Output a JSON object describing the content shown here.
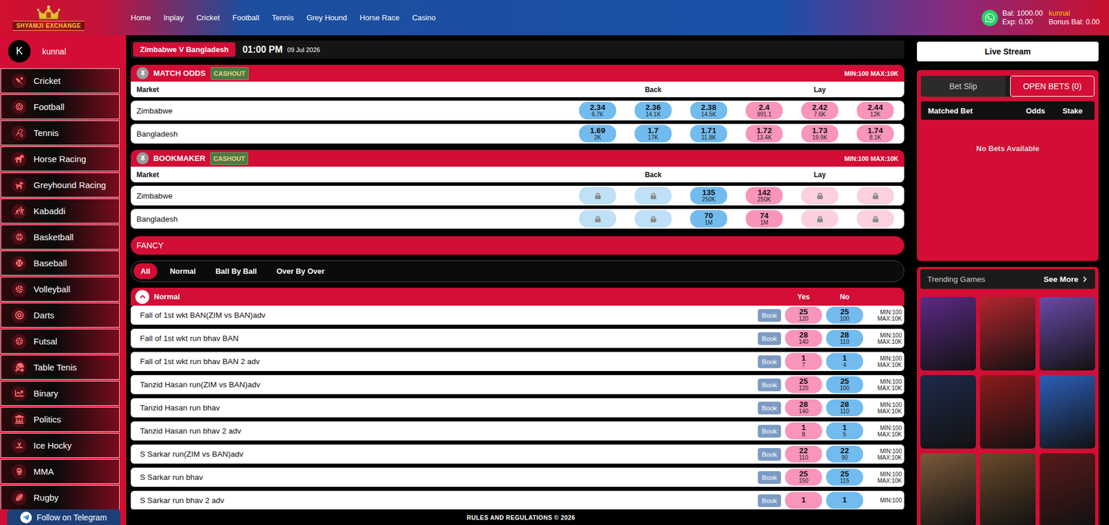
{
  "header": {
    "logo": {
      "left": "SHYAMJI",
      "right": "EXCHANGE"
    },
    "nav": [
      {
        "label": "Home"
      },
      {
        "label": "Inplay"
      },
      {
        "label": "Cricket"
      },
      {
        "label": "Football"
      },
      {
        "label": "Tennis"
      },
      {
        "label": "Grey Hound"
      },
      {
        "label": "Horse Race"
      },
      {
        "label": "Casino"
      }
    ],
    "balance": "Bal: 1000.00",
    "username": "kunnal",
    "exposure": "Exp: 0.00",
    "bonus": "Bonus Bal: 0.00"
  },
  "sidebar": {
    "user": {
      "initial": "K",
      "name": "kunnal"
    },
    "items": [
      {
        "label": "Cricket"
      },
      {
        "label": "Football"
      },
      {
        "label": "Tennis"
      },
      {
        "label": "Horse Racing"
      },
      {
        "label": "Greyhound Racing"
      },
      {
        "label": "Kabaddi"
      },
      {
        "label": "Basketball"
      },
      {
        "label": "Baseball"
      },
      {
        "label": "Volleyball"
      },
      {
        "label": "Darts"
      },
      {
        "label": "Futsal"
      },
      {
        "label": "Table Tenis"
      },
      {
        "label": "Binary"
      },
      {
        "label": "Politics"
      },
      {
        "label": "Ice Hocky"
      },
      {
        "label": "MMA"
      },
      {
        "label": "Rugby"
      }
    ],
    "telegram": "Follow on Telegram"
  },
  "match": {
    "title": "Zimbabwe V Bangladesh",
    "time": "01:00 PM",
    "date": "09 Jul 2026"
  },
  "markets": [
    {
      "title": "MATCH ODDS",
      "cashout": "CASHOUT",
      "limits": "MIN:100 MAX:10K",
      "columns": {
        "market": "Market",
        "back": "Back",
        "lay": "Lay"
      },
      "rows": [
        {
          "name": "Zimbabwe",
          "back": [
            {
              "price": "2.34",
              "size": "6.7K",
              "locked": false
            },
            {
              "price": "2.36",
              "size": "14.1K",
              "locked": false
            },
            {
              "price": "2.38",
              "size": "14.5K",
              "locked": false
            }
          ],
          "lay": [
            {
              "price": "2.4",
              "size": "991.1",
              "locked": false
            },
            {
              "price": "2.42",
              "size": "7.6K",
              "locked": false
            },
            {
              "price": "2.44",
              "size": "12K",
              "locked": false
            }
          ]
        },
        {
          "name": "Bangladesh",
          "back": [
            {
              "price": "1.69",
              "size": "2K",
              "locked": false
            },
            {
              "price": "1.7",
              "size": "17K",
              "locked": false
            },
            {
              "price": "1.71",
              "size": "11.8K",
              "locked": false
            }
          ],
          "lay": [
            {
              "price": "1.72",
              "size": "13.4K",
              "locked": false
            },
            {
              "price": "1.73",
              "size": "19.9K",
              "locked": false
            },
            {
              "price": "1.74",
              "size": "8.1K",
              "locked": false
            }
          ]
        }
      ]
    },
    {
      "title": "BOOKMAKER",
      "cashout": "CASHOUT",
      "limits": "MIN:100 MAX:10K",
      "columns": {
        "market": "Market",
        "back": "Back",
        "lay": "Lay"
      },
      "rows": [
        {
          "name": "Zimbabwe",
          "back": [
            {
              "locked": true
            },
            {
              "locked": true
            },
            {
              "price": "135",
              "size": "250K",
              "locked": false
            }
          ],
          "lay": [
            {
              "price": "142",
              "size": "250K",
              "locked": false
            },
            {
              "locked": true
            },
            {
              "locked": true
            }
          ]
        },
        {
          "name": "Bangladesh",
          "back": [
            {
              "locked": true
            },
            {
              "locked": true
            },
            {
              "price": "70",
              "size": "1M",
              "locked": false
            }
          ],
          "lay": [
            {
              "price": "74",
              "size": "1M",
              "locked": false
            },
            {
              "locked": true
            },
            {
              "locked": true
            }
          ]
        }
      ]
    }
  ],
  "fancy": {
    "title": "FANCY",
    "filters": [
      {
        "label": "All",
        "selected": true
      },
      {
        "label": "Normal",
        "selected": false
      },
      {
        "label": "Ball By Ball",
        "selected": false
      },
      {
        "label": "Over By Over",
        "selected": false
      }
    ],
    "section": {
      "title": "Normal",
      "expanded": true,
      "yes": "Yes",
      "no": "No"
    },
    "rows": [
      {
        "name": "Fall of 1st wkt BAN(ZIM vs BAN)adv",
        "book": "Book",
        "yes": {
          "price": "25",
          "size": "120"
        },
        "no": {
          "price": "25",
          "size": "100"
        },
        "min": "MIN:100",
        "max": "MAX:10K"
      },
      {
        "name": "Fall of 1st wkt run bhav BAN",
        "book": "Book",
        "yes": {
          "price": "28",
          "size": "140"
        },
        "no": {
          "price": "28",
          "size": "110"
        },
        "min": "MIN:100",
        "max": "MAX:10K"
      },
      {
        "name": "Fall of 1st wkt run bhav BAN 2 adv",
        "book": "Book",
        "yes": {
          "price": "1",
          "size": "7"
        },
        "no": {
          "price": "1",
          "size": "4"
        },
        "min": "MIN:100",
        "max": "MAX:10K"
      },
      {
        "name": "Tanzid Hasan run(ZIM vs BAN)adv",
        "book": "Book",
        "yes": {
          "price": "25",
          "size": "120"
        },
        "no": {
          "price": "25",
          "size": "100"
        },
        "min": "MIN:100",
        "max": "MAX:10K"
      },
      {
        "name": "Tanzid Hasan run bhav",
        "book": "Book",
        "yes": {
          "price": "28",
          "size": "140"
        },
        "no": {
          "price": "28",
          "size": "110"
        },
        "min": "MIN:100",
        "max": "MAX:10K"
      },
      {
        "name": "Tanzid Hasan run bhav 2 adv",
        "book": "Book",
        "yes": {
          "price": "1",
          "size": "8"
        },
        "no": {
          "price": "1",
          "size": "5"
        },
        "min": "MIN:100",
        "max": "MAX:10K"
      },
      {
        "name": "S Sarkar run(ZIM vs BAN)adv",
        "book": "Book",
        "yes": {
          "price": "22",
          "size": "110"
        },
        "no": {
          "price": "22",
          "size": "90"
        },
        "min": "MIN:100",
        "max": "MAX:10K"
      },
      {
        "name": "S Sarkar run bhav",
        "book": "Book",
        "yes": {
          "price": "25",
          "size": "150"
        },
        "no": {
          "price": "25",
          "size": "115"
        },
        "min": "MIN:100",
        "max": "MAX:10K"
      },
      {
        "name": "S Sarkar run bhav 2 adv",
        "book": "Book",
        "yes": {
          "price": "1"
        },
        "no": {
          "price": "1"
        },
        "min": "MIN:100"
      }
    ]
  },
  "footer": "RULES AND REGULATIONS © 2026",
  "right": {
    "live_stream": "Live Stream",
    "tabs": [
      {
        "label": "Bet Slip",
        "selected": false
      },
      {
        "label": "OPEN BETS (0)",
        "selected": true
      }
    ],
    "columns": [
      "Matched Bet",
      "Odds",
      "Stake"
    ],
    "empty": "No Bets Available",
    "trending": {
      "title": "Trending Games",
      "see_more": "See More",
      "tiles": [
        {
          "color": "#5b2a86"
        },
        {
          "color": "#b3262e"
        },
        {
          "color": "#6a4aa8"
        },
        {
          "color": "#1e2a4a"
        },
        {
          "color": "#8c1b1b"
        },
        {
          "color": "#2b5fb8"
        },
        {
          "color": "#7a5a3a"
        },
        {
          "color": "#6a4a2a"
        },
        {
          "color": "#5a1a1a"
        }
      ]
    }
  }
}
